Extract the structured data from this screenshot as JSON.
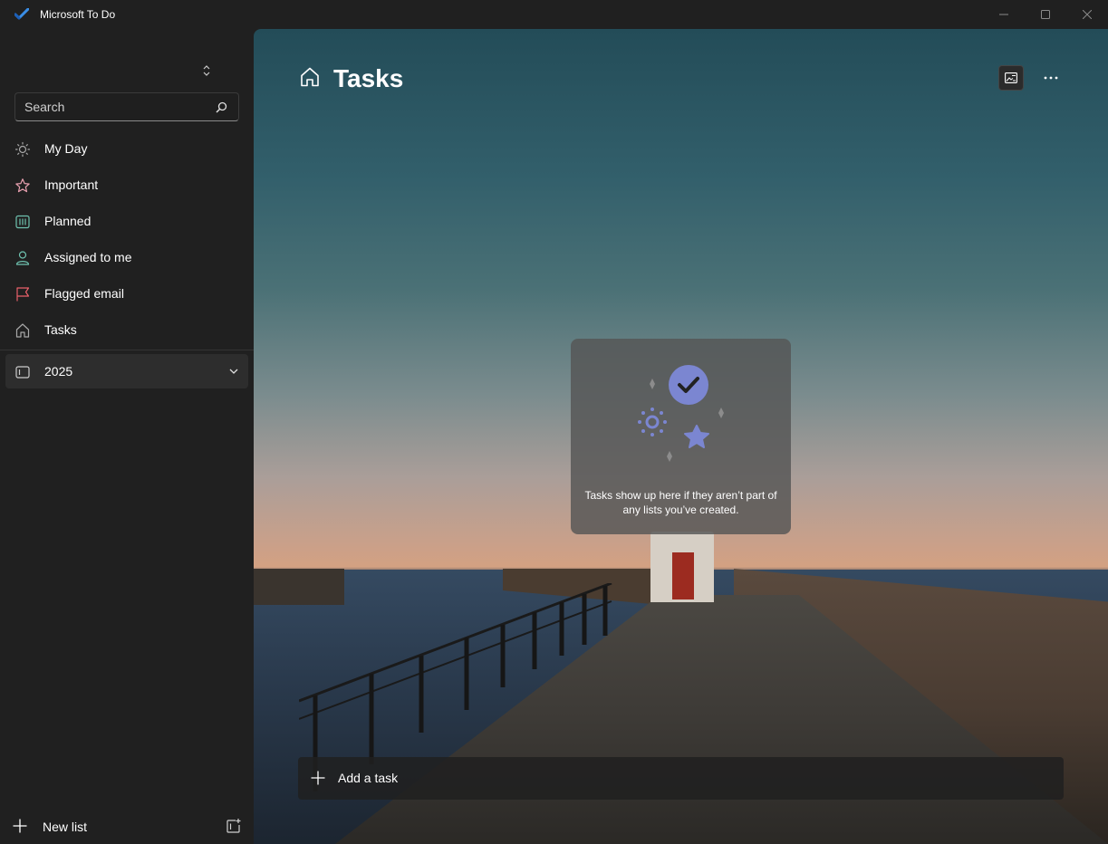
{
  "window": {
    "title": "Microsoft To Do",
    "controls": [
      "minimize-icon",
      "maximize-icon",
      "close-icon"
    ]
  },
  "sidebar": {
    "search": {
      "placeholder": "Search",
      "value": ""
    },
    "items": [
      {
        "label": "My Day",
        "icon": "sun-icon",
        "color": "#a8a8a8"
      },
      {
        "label": "Important",
        "icon": "star-icon",
        "color": "#e8a0b0"
      },
      {
        "label": "Planned",
        "icon": "calendar-grid-icon",
        "color": "#6fc3b0"
      },
      {
        "label": "Assigned to me",
        "icon": "person-icon",
        "color": "#6fc3b0"
      },
      {
        "label": "Flagged email",
        "icon": "flag-icon",
        "color": "#e8606a"
      },
      {
        "label": "Tasks",
        "icon": "home-icon",
        "color": "#a8a8a8"
      }
    ],
    "groups": [
      {
        "label": "2025",
        "icon": "list-group-icon",
        "expanded": false
      }
    ],
    "new_list_label": "New list"
  },
  "main": {
    "title": "Tasks",
    "empty_state": "Tasks show up here if they aren’t part of any lists you’ve created.",
    "add_task_placeholder": "Add a task"
  },
  "colors": {
    "accent": "#7b86d1",
    "sidebar_bg": "#202020",
    "card_bg": "#555555"
  }
}
